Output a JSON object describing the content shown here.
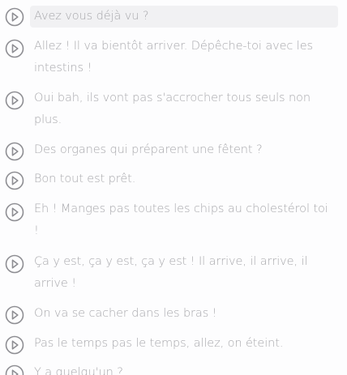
{
  "lines": [
    {
      "text": "Avez vous déjà vu ?",
      "active": true
    },
    {
      "text": "Allez ! Il va bientôt arriver. Dépêche-toi avec les intestins !"
    },
    {
      "text": "Oui bah, ils vont pas s'accrocher tous seuls non plus."
    },
    {
      "text": "Des organes qui préparent une fêtent ?"
    },
    {
      "text": "Bon tout est prêt."
    },
    {
      "text": "Eh ! Manges pas toutes les chips au cholestérol toi !"
    },
    {
      "text": "Ça y est, ça y est, ça y est ! Il arrive, il arrive, il arrive !"
    },
    {
      "text": "On va se cacher dans les bras !"
    },
    {
      "text": "Pas le temps pas le temps, allez, on éteint."
    },
    {
      "text": "Y a quelqu'un ?"
    }
  ],
  "icon": "play-circle-icon",
  "colors": {
    "text": "#a9a9ad",
    "icon": "#8e8e93",
    "active_bg": "#f1f1f3",
    "background": "#fdfdfe"
  }
}
